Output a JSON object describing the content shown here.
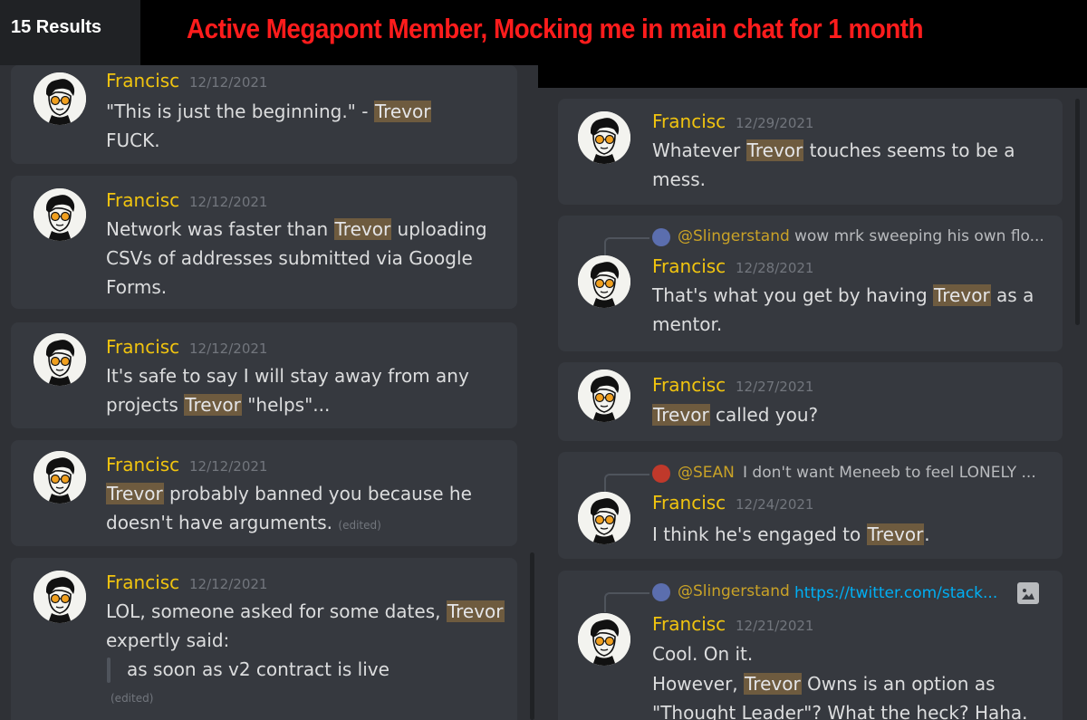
{
  "header": {
    "results_count": "15 Results"
  },
  "banner": {
    "title": "Active Megapont Member, Mocking me in main chat for 1 month"
  },
  "highlight_term": "Trevor",
  "edited_label": "(edited)",
  "left_results": [
    {
      "author": "Francisc",
      "timestamp": "12/12/2021",
      "line1_pre": "\"This is just the beginning.\" - ",
      "line1_hl": "Trevor",
      "line2": "FUCK."
    },
    {
      "author": "Francisc",
      "timestamp": "12/12/2021",
      "line1_pre": "Network was faster than ",
      "line1_hl": "Trevor",
      "line1_post": " uploading",
      "line2": "CSVs of addresses submitted via Google",
      "line3": "Forms."
    },
    {
      "author": "Francisc",
      "timestamp": "12/12/2021",
      "line1": "It's safe to say I will stay away from any",
      "line2_pre": "projects ",
      "line2_hl": "Trevor",
      "line2_post": " \"helps\"..."
    },
    {
      "author": "Francisc",
      "timestamp": "12/12/2021",
      "line1_hl": "Trevor",
      "line1_post": " probably banned you because he",
      "line2": "doesn't have arguments. "
    },
    {
      "author": "Francisc",
      "timestamp": "12/12/2021",
      "line1_pre": "LOL, someone asked for some dates, ",
      "line1_hl": "Trevor",
      "line2": "expertly said:",
      "quote": "as soon as v2 contract is live"
    }
  ],
  "right_results": [
    {
      "author": "Francisc",
      "timestamp": "12/29/2021",
      "line1_pre": "Whatever ",
      "line1_hl": "Trevor",
      "line1_post": " touches seems to be a",
      "line2": "mess."
    },
    {
      "reply_name": "@Slingerstand",
      "reply_text": "wow mrk sweeping his own flo...",
      "author": "Francisc",
      "timestamp": "12/28/2021",
      "line1_pre": "That's what you get by having ",
      "line1_hl": "Trevor",
      "line1_post": " as a",
      "line2": "mentor."
    },
    {
      "author": "Francisc",
      "timestamp": "12/27/2021",
      "line1_hl": "Trevor",
      "line1_post": " called you?"
    },
    {
      "reply_name": "@SEAN",
      "reply_text": "I don't want Meneeb to feel LONELY ...",
      "author": "Francisc",
      "timestamp": "12/24/2021",
      "line1_pre": "I think he's engaged to ",
      "line1_hl": "Trevor",
      "line1_post": "."
    },
    {
      "reply_name": "@Slingerstand",
      "reply_link": "https://twitter.com/stack...",
      "reply_icon": "image-icon",
      "author": "Francisc",
      "timestamp": "12/21/2021",
      "line1": "Cool. On it.",
      "line2_pre": "However, ",
      "line2_hl": "Trevor",
      "line2_post": " Owns is an option as",
      "line3": "\"Thought Leader\"? What the heck? Haha."
    }
  ],
  "colors": {
    "author": "#f1c40f",
    "highlight_bg": "#6e5b3f",
    "banner_text": "#ff1c1c",
    "link": "#00aff4"
  }
}
